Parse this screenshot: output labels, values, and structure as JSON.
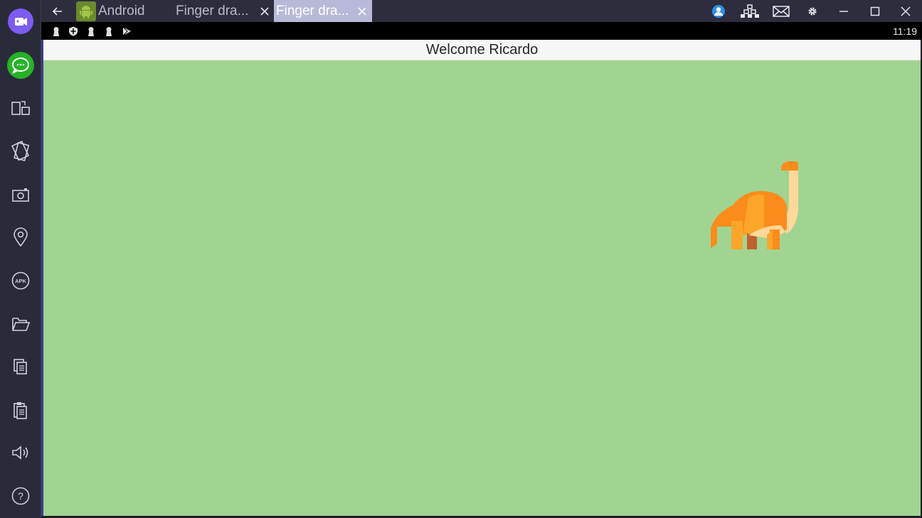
{
  "window": {
    "tabs": [
      {
        "label": "Android",
        "active": false
      },
      {
        "label": "Finger dra...",
        "active": false
      },
      {
        "label": "Finger dra...",
        "active": true
      }
    ]
  },
  "status_bar": {
    "time": "11:19"
  },
  "app": {
    "header_title": "Welcome Ricardo",
    "background_color": "#a1d490",
    "character": "dinosaur-icon"
  },
  "sidebar": {
    "items": [
      "video-call-icon",
      "chat-icon",
      "screen-rotate-icon",
      "shake-icon",
      "camera-icon",
      "location-icon",
      "apk-icon",
      "folder-icon",
      "copy-icon",
      "clipboard-icon",
      "volume-icon",
      "help-icon"
    ],
    "apk_label": "APK",
    "help_label": "?"
  },
  "toolbar_icons": [
    "account-icon",
    "multi-instance-icon",
    "mail-icon",
    "gear-icon",
    "minimize-icon",
    "maximize-icon",
    "close-icon"
  ]
}
